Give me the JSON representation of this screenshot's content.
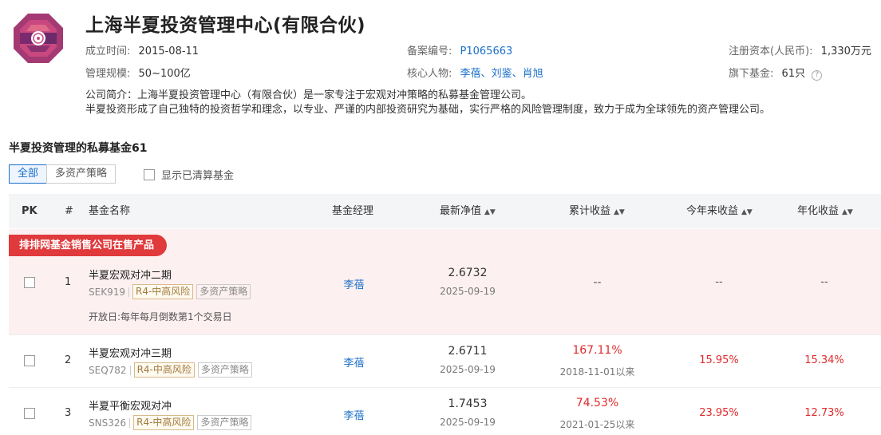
{
  "company": {
    "name": "上海半夏投资管理中心(有限合伙)",
    "logo_icon": "company-logo-octagon",
    "established_label": "成立时间:",
    "established": "2015-08-11",
    "record_no_label": "备案编号:",
    "record_no": "P1065663",
    "capital_label": "注册资本(人民币):",
    "capital": "1,330万元",
    "scale_label": "管理规模:",
    "scale": "50~100亿",
    "key_people_label": "核心人物:",
    "key_people": [
      "李蓓",
      "刘鉴",
      "肖旭"
    ],
    "people_sep": "、",
    "funds_count_label": "旗下基金:",
    "funds_count": "61只",
    "intro_line1": "公司简介：上海半夏投资管理中心（有限合伙）是一家专注于宏观对冲策略的私募基金管理公司。",
    "intro_line2": "半夏投资形成了自己独特的投资哲学和理念，以专业、严谨的内部投资研究为基础，实行严格的风险管理制度，致力于成为全球领先的资产管理公司。"
  },
  "section": {
    "title": "半夏投资管理的私募基金61"
  },
  "filters": {
    "tabs": [
      "全部",
      "多资产策略"
    ],
    "active_tab": 0,
    "show_cleared_label": "显示已清算基金"
  },
  "table": {
    "headers": {
      "pk": "PK",
      "index": "#",
      "name": "基金名称",
      "manager": "基金经理",
      "nav": "最新净值",
      "cumulative": "累计收益",
      "ytd": "今年来收益",
      "annualized": "年化收益"
    },
    "sort_icon": "sort-updown-icon",
    "badge": "排排网基金销售公司在售产品",
    "open_day_label": "开放日:",
    "rows": [
      {
        "index": "1",
        "name": "半夏宏观对冲二期",
        "code": "SEK919",
        "risk": "R4-中高风险",
        "strategy": "多资产策略",
        "open_day": "每年每月倒数第1个交易日",
        "manager": "李蓓",
        "nav": "2.6732",
        "nav_date": "2025-09-19",
        "cumulative": "--",
        "cumulative_since": "",
        "ytd": "--",
        "annualized": "--"
      },
      {
        "index": "2",
        "name": "半夏宏观对冲三期",
        "code": "SEQ782",
        "risk": "R4-中高风险",
        "strategy": "多资产策略",
        "manager": "李蓓",
        "nav": "2.6711",
        "nav_date": "2025-09-19",
        "cumulative": "167.11%",
        "cumulative_since": "2018-11-01以来",
        "ytd": "15.95%",
        "annualized": "15.34%"
      },
      {
        "index": "3",
        "name": "半夏平衡宏观对冲",
        "code": "SNS326",
        "risk": "R4-中高风险",
        "strategy": "多资产策略",
        "manager": "李蓓",
        "nav": "1.7453",
        "nav_date": "2025-09-19",
        "cumulative": "74.53%",
        "cumulative_since": "2021-01-25以来",
        "ytd": "23.95%",
        "annualized": "12.73%"
      }
    ]
  },
  "colors": {
    "accent": "#1a6fc9",
    "gain": "#e02a2c",
    "badge": "#e03a3c",
    "highlight_row": "#fdf0f1"
  }
}
